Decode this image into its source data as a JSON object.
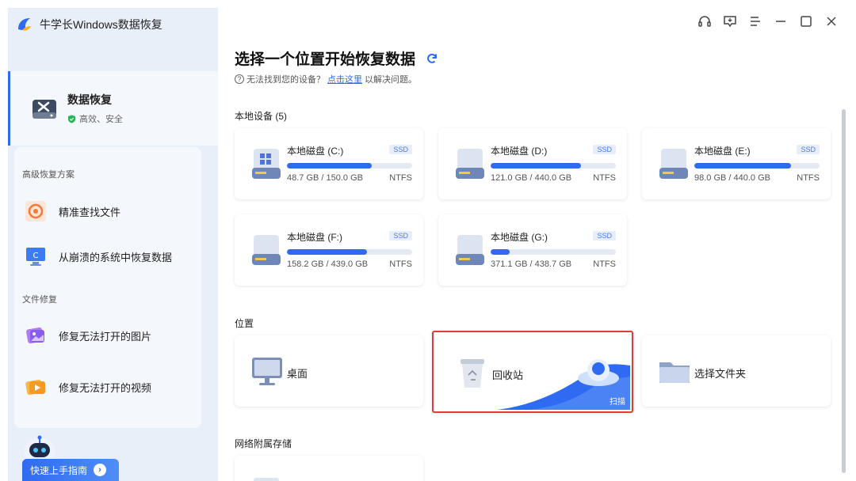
{
  "app": {
    "title": "牛学长Windows数据恢复"
  },
  "nav": {
    "main": {
      "title": "数据恢复",
      "subtitle": "高效、安全"
    },
    "section_advanced": "高级恢复方案",
    "section_repair": "文件修复",
    "items": [
      {
        "label": "精准查找文件",
        "icon": "target-file-icon"
      },
      {
        "label": "从崩溃的系统中恢复数据",
        "icon": "crashed-system-icon"
      },
      {
        "label": "修复无法打开的图片",
        "icon": "photo-repair-icon"
      },
      {
        "label": "修复无法打开的视频",
        "icon": "video-repair-icon"
      }
    ],
    "guide_label": "快速上手指南"
  },
  "window_controls": [
    "headset-icon",
    "feedback-icon",
    "menu-icon",
    "minimize-icon",
    "maximize-icon",
    "close-icon"
  ],
  "main": {
    "title": "选择一个位置开始恢复数据",
    "help_prefix": "无法找到您的设备？",
    "help_link": "点击这里",
    "help_suffix": "以解决问题。",
    "local_devices_label": "本地设备 (5)",
    "drives": [
      {
        "name": "本地磁盘 (C:)",
        "type": "SSD",
        "size": "48.7 GB / 150.0 GB",
        "fs": "NTFS",
        "usage": 0.68
      },
      {
        "name": "本地磁盘 (D:)",
        "type": "SSD",
        "size": "121.0 GB / 440.0 GB",
        "fs": "NTFS",
        "usage": 0.72
      },
      {
        "name": "本地磁盘 (E:)",
        "type": "SSD",
        "size": "98.0 GB / 440.0 GB",
        "fs": "NTFS",
        "usage": 0.77
      },
      {
        "name": "本地磁盘 (F:)",
        "type": "SSD",
        "size": "158.2 GB / 439.0 GB",
        "fs": "NTFS",
        "usage": 0.64
      },
      {
        "name": "本地磁盘 (G:)",
        "type": "SSD",
        "size": "371.1 GB / 438.7 GB",
        "fs": "NTFS",
        "usage": 0.15
      }
    ],
    "location_label": "位置",
    "locations": [
      {
        "label": "桌面"
      },
      {
        "label": "回收站",
        "scan": "扫描"
      },
      {
        "label": "选择文件夹"
      }
    ],
    "nas_label": "网络附属存储"
  },
  "colors": {
    "accent": "#2e6bf2",
    "sidebar_bg": "#e9eff8",
    "highlight_border": "#e03a3a"
  }
}
